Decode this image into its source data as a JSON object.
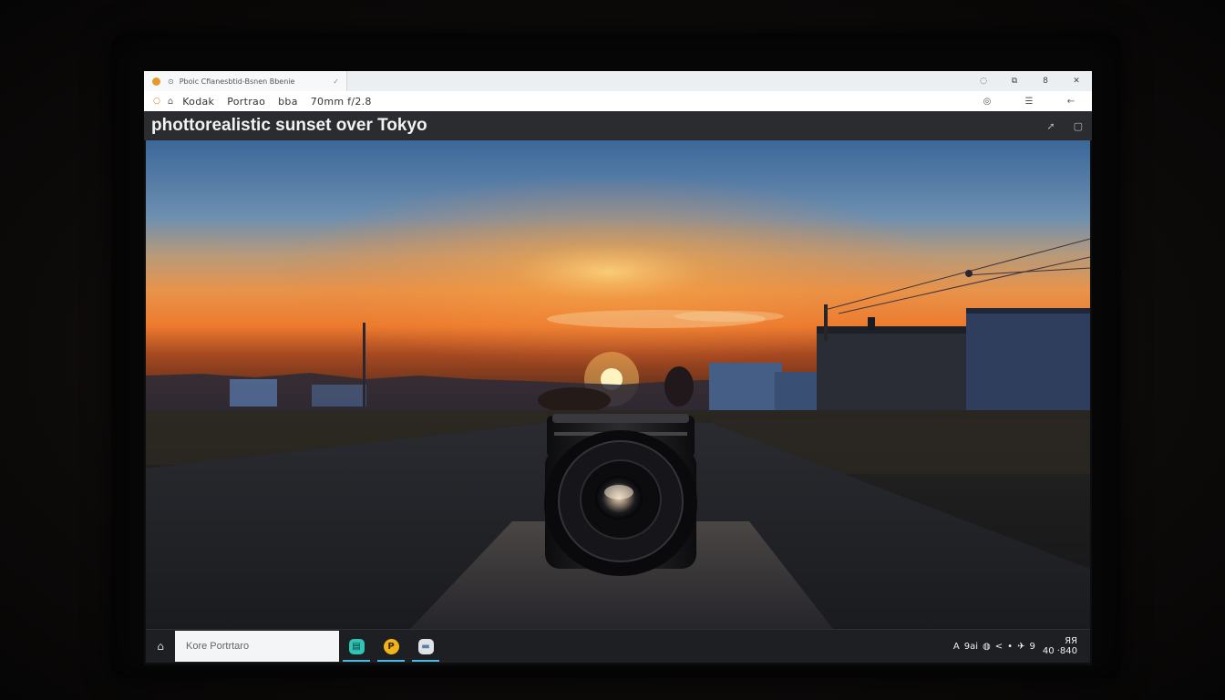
{
  "browser": {
    "tab_title": "Pboic Cfianesbtid-Bsnen Bbenie",
    "tab_close": "✓",
    "window_controls": [
      "◌",
      "⧉",
      "8",
      "✕"
    ]
  },
  "toolbar": {
    "left_icon": "○",
    "items": [
      "⌂",
      "Kodak",
      "Portrao",
      "bba",
      "70mm f/2.8"
    ],
    "right_icons": [
      "◎",
      "☰",
      "←"
    ]
  },
  "heading": {
    "title": "phottorealistic sunset over Tokyo",
    "icons": [
      "➚",
      "▢"
    ]
  },
  "taskbar": {
    "start_icon": "⌂",
    "search_placeholder": "Kore Portrtaro",
    "apps": [
      {
        "glyph": "▤",
        "color": "#2ec4b6",
        "text_color": "#0d3a36"
      },
      {
        "glyph": "P",
        "color": "#f2b21c",
        "text_color": "#3a2a00"
      },
      {
        "glyph": "▬",
        "color": "#dfe3e8",
        "text_color": "#5a7ea8"
      }
    ],
    "tray": [
      "A",
      "9ai",
      "◍",
      "<",
      "•",
      "✈",
      "9"
    ],
    "clock_top": "ЯЯ",
    "clock_bottom": "40 ‧840"
  },
  "colors": {
    "sky_top": "#3e6a9c",
    "horizon": "#f2a64a",
    "sun": "#fff6c8",
    "ground": "#1a1c20"
  }
}
